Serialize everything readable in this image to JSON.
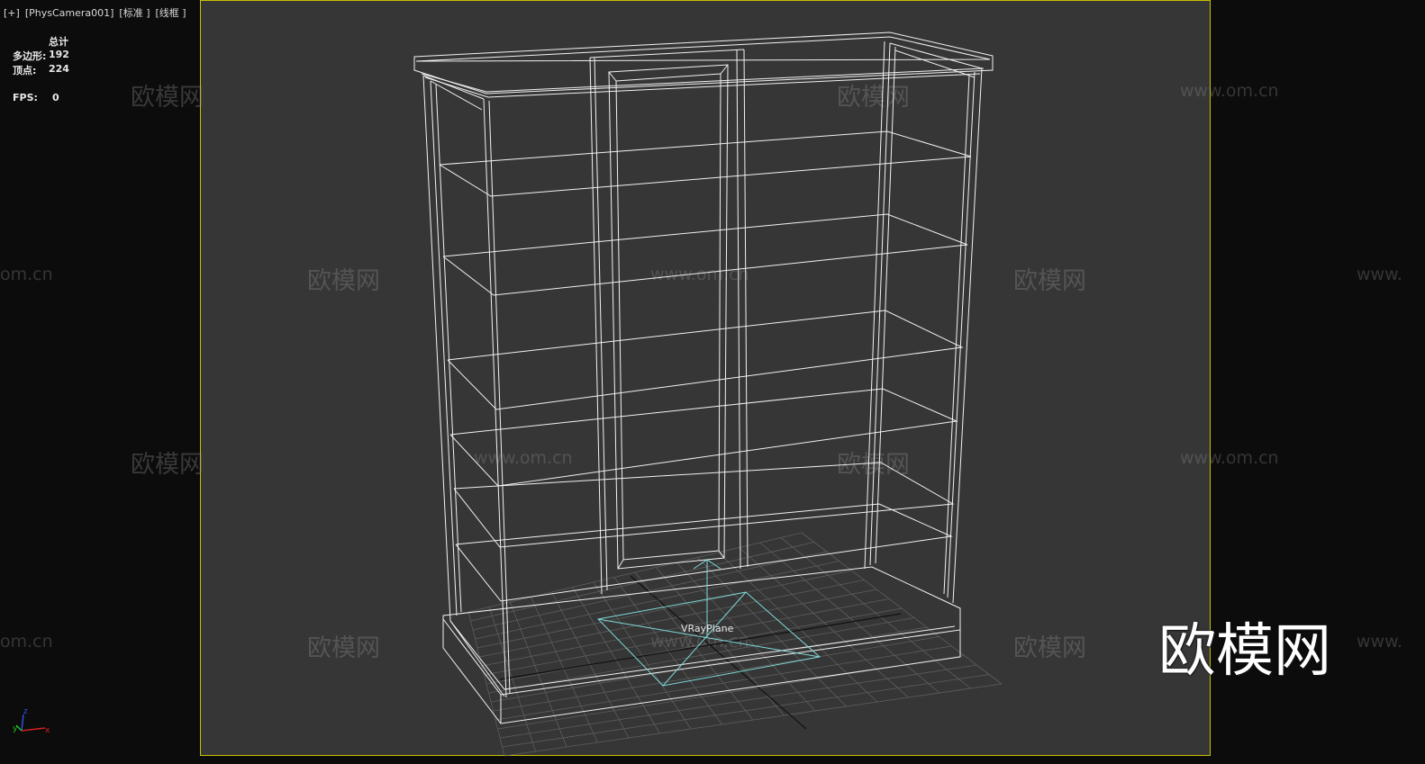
{
  "viewport": {
    "plus_label": "[+]",
    "camera_label": "[PhysCamera001]",
    "shading_label": "[标准 ]",
    "mode_label": "[线框 ]"
  },
  "stats": {
    "header": "总计",
    "polygons_label": "多边形:",
    "polygons_value": "192",
    "vertices_label": "顶点:",
    "vertices_value": "224",
    "fps_label": "FPS:",
    "fps_value": "0"
  },
  "object_label": "VRayPlane",
  "watermark": {
    "brand": "欧模网",
    "url": "www.om.cn",
    "url_left_partial": "om.cn",
    "url_right_partial": "www."
  },
  "gizmo": {
    "z": "z",
    "y": "y",
    "x": "x"
  },
  "colors": {
    "viewport_bg": "#363636",
    "outer_bg": "#0c0c0c",
    "safe_frame": "#c8c000",
    "wire": "#ffffff",
    "grid": "#6a6a6a",
    "vrayplane": "#7fd8d8"
  }
}
